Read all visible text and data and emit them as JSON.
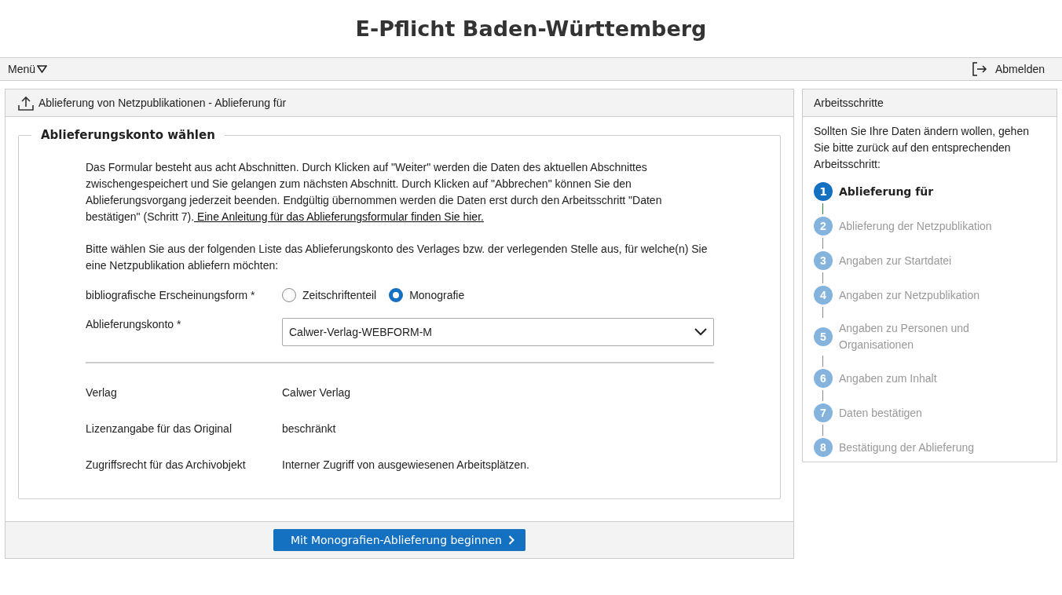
{
  "header": {
    "title": "E-Pflicht Baden-Württemberg"
  },
  "menubar": {
    "menu": "Menü",
    "logout": "Abmelden"
  },
  "main_panel": {
    "title": "Ablieferung von Netzpublikationen - Ablieferung für",
    "fieldset": {
      "legend": "Ablieferungskonto wählen",
      "intro": {
        "text": "Das Formular besteht aus acht Abschnitten. Durch Klicken auf \"Weiter\" werden die Daten des aktuellen Abschnittes zwischengespeichert und Sie gelangen zum nächsten Abschnitt. Durch Klicken auf \"Abbrechen\" können Sie den Ablieferungsvorgang jederzeit beenden. Endgültig übernommen werden die Daten erst durch den Arbeitsschritt \"Daten bestätigen\" (Schritt 7).",
        "link": " Eine Anleitung für das Ablieferungsformular finden Sie hier."
      },
      "instruction": "Bitte wählen Sie aus der folgenden Liste das Ablieferungskonto des Verlages bzw. der verlegenden Stelle aus, für welche(n) Sie eine Netzpublikation abliefern möchten:",
      "form_type": {
        "label": "bibliografische Erscheinungsform *",
        "options": [
          {
            "label": "Zeitschriftenteil",
            "selected": false
          },
          {
            "label": "Monografie",
            "selected": true
          }
        ]
      },
      "account": {
        "label": "Ablieferungskonto *",
        "value": "Calwer-Verlag-WEBFORM-M"
      },
      "details": [
        {
          "label": "Verlag",
          "value": "Calwer Verlag"
        },
        {
          "label": "Lizenzangabe für das Original",
          "value": "beschränkt"
        },
        {
          "label": "Zugriffsrecht für das Archivobjekt",
          "value": "Interner Zugriff von ausgewiesenen Arbeitsplätzen."
        }
      ]
    },
    "submit": "Mit Monografien-Ablieferung beginnen"
  },
  "steps_panel": {
    "title": "Arbeitsschritte",
    "hint": "Sollten Sie Ihre Daten ändern wollen, gehen Sie bitte zurück auf den entsprechenden Arbeitsschritt:",
    "steps": [
      {
        "number": "1",
        "label": "Ablieferung für",
        "selected": true
      },
      {
        "number": "2",
        "label": "Ablieferung der Netzpublikation",
        "selected": false
      },
      {
        "number": "3",
        "label": "Angaben zur Startdatei",
        "selected": false
      },
      {
        "number": "4",
        "label": "Angaben zur Netzpublikation",
        "selected": false
      },
      {
        "number": "5",
        "label": "Angaben zu Personen und Organisationen",
        "selected": false
      },
      {
        "number": "6",
        "label": "Angaben zum Inhalt",
        "selected": false
      },
      {
        "number": "7",
        "label": "Daten bestätigen",
        "selected": false
      },
      {
        "number": "8",
        "label": "Bestätigung der Ablieferung",
        "selected": false
      }
    ]
  }
}
